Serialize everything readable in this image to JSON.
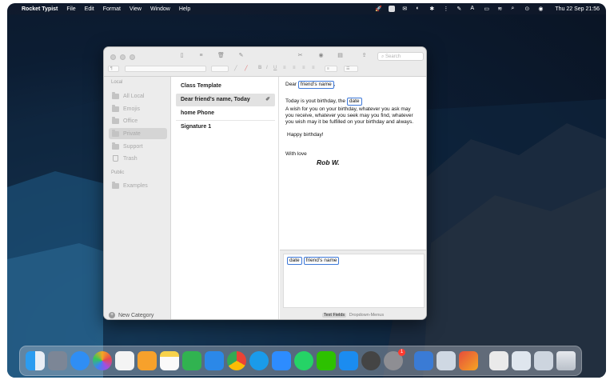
{
  "menubar": {
    "app_name": "Rocket Typist",
    "menus": [
      "File",
      "Edit",
      "Format",
      "View",
      "Window",
      "Help"
    ],
    "clock": "Thu 22 Sep  21:56"
  },
  "toolbar": {
    "search_placeholder": "Search"
  },
  "sidebar": {
    "local_heading": "Local",
    "public_heading": "Public",
    "items": [
      {
        "label": "All Local",
        "selected": false
      },
      {
        "label": "Emojis",
        "selected": false
      },
      {
        "label": "Office",
        "selected": false
      },
      {
        "label": "Private",
        "selected": true
      },
      {
        "label": "Support",
        "selected": false
      },
      {
        "label": "Trash",
        "selected": false
      }
    ],
    "public_items": [
      {
        "label": "Examples"
      }
    ],
    "new_category": "New Category"
  },
  "snippets": [
    {
      "title": "Class Template",
      "selected": false
    },
    {
      "title": "Dear friend's name,  Today",
      "selected": true
    },
    {
      "title": "home Phone",
      "selected": false
    },
    {
      "title": "Signature 1",
      "selected": false
    }
  ],
  "editor": {
    "dear": "Dear",
    "friend_field": "friend's name",
    "comma": ",",
    "today_text": "Today is yout birthday, the",
    "date_field": "date",
    "wish_line1": "A wish for you on your birthday, whatever you ask may",
    "wish_line2": "you receive, whatever you seek may you find, whatever",
    "wish_line3": "you wish may it be fulfilled on your birthday and always.",
    "happy": "Happy birthday!",
    "with_love": "With love",
    "signature": "Rob W."
  },
  "fields_panel": {
    "chips": [
      "date",
      "friend's name"
    ],
    "tabs": [
      "Text Fields",
      "Dropdown-Menus"
    ],
    "active_tab": "Text Fields"
  },
  "dock": {
    "apps": [
      "finder-icon",
      "launchpad-icon",
      "safari-icon",
      "photos-icon",
      "reminders-icon",
      "pages-icon",
      "notes-icon",
      "numbers-icon",
      "keynote-icon",
      "chrome-icon",
      "skype-icon",
      "zoom-icon",
      "whatsapp-icon",
      "wechat-icon",
      "app-store-icon",
      "quicktime-icon",
      "system-preferences-icon",
      "migration-icon",
      "screen-icon",
      "rocket-typist-icon",
      "folder-stack-icon",
      "document-stack-icon",
      "downloads-icon",
      "trash-icon"
    ],
    "badge": "1",
    "colors": {
      "accent": "#3d78d8"
    }
  }
}
